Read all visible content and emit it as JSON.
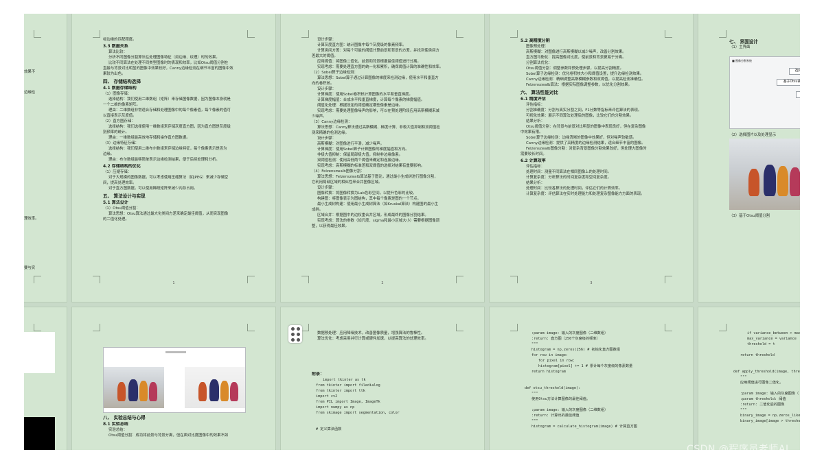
{
  "pages": {
    "p0": [
      "标边缘的匹配程度。"
    ],
    "p1": [
      {
        "c": "",
        "t": "标边缘的匹配程度。"
      },
      {
        "c": "h2",
        "t": "3.3 数据关系"
      },
      {
        "c": "sub",
        "t": "算法比较："
      },
      {
        "c": "sub",
        "t": "分析不同图像分割算法在处理图像特征（如边缘、纹理）时的效果。"
      },
      {
        "c": "sub",
        "t": "比较不同算法在处理不同类型图像时的表现和效率，比如Otsu阈值分割在"
      },
      {
        "c": "",
        "t": "直接与背景对比明显的图像中效果较好，Canny边缘检测在细节丰富的图像中效"
      },
      {
        "c": "",
        "t": "果较为出色。"
      },
      {
        "c": "h1",
        "t": "四、 存储结构选择"
      },
      {
        "c": "h2",
        "t": "4.1 数据存储结构"
      },
      {
        "c": "",
        "t": "（1）图像存储："
      },
      {
        "c": "sub",
        "t": "选择结构：我们使用二维数组（矩阵）来存储图像数据，因为图像本身就是"
      },
      {
        "c": "",
        "t": "一个二维的像素矩阵。"
      },
      {
        "c": "sub",
        "t": "理由：二维数组非常适合存储和处理图像中的每个像素值，每个像素的值可"
      },
      {
        "c": "",
        "t": "以直接表示灰度值。"
      },
      {
        "c": "",
        "t": "（2）直方图存储："
      },
      {
        "c": "sub",
        "t": "选择结构：我们选择使用一维数组来存储灰度直方图，因为直方图是灰度级"
      },
      {
        "c": "",
        "t": "别频率的统计。"
      },
      {
        "c": "sub",
        "t": "理由：一维数组能高效地存储和操作直方图数据。"
      },
      {
        "c": "",
        "t": "（3）边缘特征存储："
      },
      {
        "c": "sub",
        "t": "选择结构：我们使用二维布尔数组来存储边缘特征，每个像素表示是否为"
      },
      {
        "c": "",
        "t": "边缘。"
      },
      {
        "c": "sub",
        "t": "理由：布尔数组能够简单表示边缘检测结果，便于后续处理和分析。"
      },
      {
        "c": "h2",
        "t": "4.2 存储结构的优化"
      },
      {
        "c": "",
        "t": "（1）压缩存储："
      },
      {
        "c": "sub",
        "t": "对于大规模的图像数据，可以考虑使用压缩算法（如JPEG）来减少存储空"
      },
      {
        "c": "",
        "t": "间，提高处理效率。"
      },
      {
        "c": "sub",
        "t": "对于直方图数据，可以使用稀疏矩阵来减少内存占用。"
      },
      {
        "c": "h1",
        "t": "五、 算法设计与实现"
      },
      {
        "c": "h2",
        "t": "5.1 算法设计"
      },
      {
        "c": "",
        "t": "（1）Otsu阈值分割："
      },
      {
        "c": "sub",
        "t": "算法思想：Otsu算法通过最大化类间方差来确定最佳阈值，从而实现图像"
      },
      {
        "c": "",
        "t": "的二值化处理。"
      }
    ],
    "p2": [
      {
        "c": "sub",
        "t": "设计步骤："
      },
      {
        "c": "sub",
        "t": "计算灰度直方图：统计图像中每个灰度级的像素频率。"
      },
      {
        "c": "sub",
        "t": "计算类间方差：对每个可能的阈值计算前景和背景的方差，并找到使类间方"
      },
      {
        "c": "",
        "t": "差最大的阈值。"
      },
      {
        "c": "sub",
        "t": "应用阈值：将图像二值化，前景和背景根据最佳阈值进行分离。"
      },
      {
        "c": "sub",
        "t": "实现考虑：需要处理直方图的统一化和累积，确保阈值计算的准确性和效率。"
      },
      {
        "c": "",
        "t": "（2）Sobel算子边缘检测："
      },
      {
        "c": "sub",
        "t": "算法思想：Sobel算子通过计算图像的梯度来检测边缘，使用水平和垂直方"
      },
      {
        "c": "",
        "t": "向的卷积核。"
      },
      {
        "c": "sub",
        "t": "设计步骤："
      },
      {
        "c": "sub",
        "t": "计算梯度：使用Sobel卷积核计算图像的水平和垂直梯度。"
      },
      {
        "c": "sub",
        "t": "计算梯度幅值：合成水平和垂直梯度，计算每个像素的梯度幅值。"
      },
      {
        "c": "sub",
        "t": "阈值化处理：根据设定的阈值确定哪些像素是边缘。"
      },
      {
        "c": "sub",
        "t": "实现考虑：需要处理图像噪声的影响，可以在预处理阶段应用高斯模糊来减"
      },
      {
        "c": "",
        "t": "少噪声。"
      },
      {
        "c": "",
        "t": "（3）Canny边缘检测："
      },
      {
        "c": "sub",
        "t": "算法思想：Canny算法通过高斯模糊、梯度计算、非极大值抑制和双阈值检"
      },
      {
        "c": "",
        "t": "测来精确的检测边缘。"
      },
      {
        "c": "sub",
        "t": "设计步骤："
      },
      {
        "c": "sub",
        "t": "高斯模糊：对图像进行平滑，减少噪声。"
      },
      {
        "c": "sub",
        "t": "计算梯度：使用Sobel算子计算图像的梯度幅值和方向。"
      },
      {
        "c": "sub",
        "t": "非极大值抑制：保留局部极大值，抑制非边缘像素。"
      },
      {
        "c": "sub",
        "t": "双阈值检测：使用高低两个阈值来确定和连接边缘。"
      },
      {
        "c": "sub",
        "t": "实现考虑：高斯模糊的标准差和双阈值的选择对结果有重要影响。"
      },
      {
        "c": "",
        "t": "（4）Felzenszwalb图像分割："
      },
      {
        "c": "sub",
        "t": "算法思想：Felzenszwalb算法基于图论，通过最小生成树进行图像分割，"
      },
      {
        "c": "",
        "t": "它利用局部区域的相似性来合并图像区域。"
      },
      {
        "c": "sub",
        "t": "设计步骤："
      },
      {
        "c": "sub",
        "t": "图像转换：将图像转换为Lab色彩空间，以提升色彩的比较。"
      },
      {
        "c": "sub",
        "t": "构建图：将图像表示为图结构，其中每个像素是图的一个节点。"
      },
      {
        "c": "sub",
        "t": "最小生成树构建：使用最小生成树算法（如Kruskal算法）构建图的最小生"
      },
      {
        "c": "",
        "t": "成树。"
      },
      {
        "c": "sub",
        "t": "区域合并：根据图中的边权重合并区域，形成最终的图像分割结果。"
      },
      {
        "c": "sub",
        "t": "实现考虑：算法的参数（如尺度、sigma和最小区域大小）需要根据图像调"
      },
      {
        "c": "",
        "t": "整，以获得最佳效果。"
      }
    ],
    "p3": [
      {
        "c": "h2",
        "t": "5.2 高精度分割"
      },
      {
        "c": "sub",
        "t": "图像预处理："
      },
      {
        "c": "sub",
        "t": "高斯模糊：对图像进行高斯模糊以减少噪声，改善分割效果。"
      },
      {
        "c": "sub",
        "t": "直方图均衡化：提高图像对比度，使前景和背景更易于分离。"
      },
      {
        "c": "sub",
        "t": "分割算法优化："
      },
      {
        "c": "sub",
        "t": "Otsu阈值分割：调整参数和预处理步骤，以提高分割精度。"
      },
      {
        "c": "sub",
        "t": "Sobel算子边缘检测：优化卷积核大小和阈值设置，提升边缘检测效果。"
      },
      {
        "c": "sub",
        "t": "Canny边缘检测：精细调整高斯模糊参数和双阈值，以提高检测准确性。"
      },
      {
        "c": "sub",
        "t": "Felzenszwalb算法：根据实际图像调整参数，以优化分割效果。"
      },
      {
        "c": "h1",
        "t": "六、 算法性能对比"
      },
      {
        "c": "h2",
        "t": "6.1 精度评估"
      },
      {
        "c": "sub",
        "t": "评估指标："
      },
      {
        "c": "sub",
        "t": "分割准确度：分割与真实分割之间，F1分数等指标来评估算法的表现。"
      },
      {
        "c": "sub",
        "t": "可视化效果：展示不同算法处理后的图像，比较它们的分割效果。"
      },
      {
        "c": "sub",
        "t": "结果分析："
      },
      {
        "c": "sub",
        "t": "Otsu阈值分割：在背景与前景对比明显的图像中表现良好，但在复杂图像"
      },
      {
        "c": "",
        "t": "中效果有限。"
      },
      {
        "c": "sub",
        "t": "Sobel算子边缘检测：边缘清晰的图像中效果好，但对噪声较敏感。"
      },
      {
        "c": "sub",
        "t": "Canny边缘检测：提供了高精度的边缘检测结果，适合细节丰富的图像。"
      },
      {
        "c": "sub",
        "t": "Felzenszwalb图像分割：对复杂背景图像分割效果较好，但处理大图像时"
      },
      {
        "c": "",
        "t": "需要较长时间。"
      },
      {
        "c": "h2",
        "t": "6.2 计算效率"
      },
      {
        "c": "sub",
        "t": "评估指标："
      },
      {
        "c": "sub",
        "t": "处理时间：测量不同算法在相同图像上的处理时间。"
      },
      {
        "c": "sub",
        "t": "计算复杂度：分析算法的时间复杂度和空间复杂度。"
      },
      {
        "c": "sub",
        "t": "结果分析："
      },
      {
        "c": "sub",
        "t": "处理时间：比较各算法的处理时间，评估它们的计算效率。"
      },
      {
        "c": "sub",
        "t": "计算复杂度：评估算法在实时处理能力和处理复杂图像能力方面的表现。"
      }
    ],
    "p4": [
      {
        "c": "h1",
        "t": "七、 界面设计"
      },
      {
        "c": "",
        "t": "（1）主界面"
      }
    ],
    "p4_caption2": "（2）选择图片以及处理显示",
    "p4_caption3": "（3）基于Otsu阈值分割",
    "p4_app": {
      "btn1": "选择图",
      "btn2": "基于Otsu阈值",
      "btn3": "边"
    },
    "p7": [
      {
        "c": "h1",
        "t": "八、 实验总结与心得"
      },
      {
        "c": "h2",
        "t": "8.1 实验总结"
      },
      {
        "c": "sub",
        "t": "实验总结："
      },
      {
        "c": "sub",
        "t": "Otsu阈值分割：成功将前景与背景分离，但在面对比度图像中的效果不如"
      }
    ],
    "p8_top": [
      {
        "c": "sub",
        "t": "数据预处理：应用降噪技术，改善图像质量，增强算法的鲁棒性。"
      },
      {
        "c": "sub",
        "t": "算法优化：考虑采用并行计算或硬件加速，以提高算法的处理效率。"
      }
    ],
    "p8_code": [
      {
        "c": "h2",
        "t": "附录："
      },
      {
        "c": "code i2",
        "t": "import tkinter as tk"
      },
      {
        "c": "code",
        "t": "from tkinter import filedialog"
      },
      {
        "c": "code",
        "t": "from tkinter import ttk"
      },
      {
        "c": "code",
        "t": "import cv2"
      },
      {
        "c": "code",
        "t": "from PIL import Image, ImageTk"
      },
      {
        "c": "code",
        "t": "import numpy as np"
      },
      {
        "c": "code",
        "t": "from skimage import segmentation, color"
      },
      {
        "c": "code",
        "t": ""
      },
      {
        "c": "code",
        "t": ""
      },
      {
        "c": "code",
        "t": "# 定义算法函数"
      }
    ],
    "p9": [
      {
        "c": "code i2",
        "t": ":param image: 输入的灰度图像（二维数组）"
      },
      {
        "c": "code i2",
        "t": ":return: 直方图（256个灰度级的频率）"
      },
      {
        "c": "code i2",
        "t": "\"\"\""
      },
      {
        "c": "code i2",
        "t": "histogram = np.zeros(256)  # 初始化直方图数组"
      },
      {
        "c": "code i2",
        "t": "for row in image:"
      },
      {
        "c": "code i3",
        "t": "for pixel in row:"
      },
      {
        "c": "code i3",
        "t": "    histogram[pixel] += 1  # 累计每个灰度级的像素数量"
      },
      {
        "c": "code i2",
        "t": "return histogram"
      },
      {
        "c": "code",
        "t": ""
      },
      {
        "c": "code",
        "t": ""
      },
      {
        "c": "code",
        "t": "def otsu_threshold(image):"
      },
      {
        "c": "code i2",
        "t": "\"\"\""
      },
      {
        "c": "code i2",
        "t": "使用Otsu方法计算图像的最佳阈值。"
      },
      {
        "c": "code",
        "t": ""
      },
      {
        "c": "code i2",
        "t": ":param image: 输入的灰度图像（二维数组）"
      },
      {
        "c": "code i2",
        "t": ":return: 计算出的最佳阈值"
      },
      {
        "c": "code i2",
        "t": "\"\"\""
      },
      {
        "c": "code i2",
        "t": "histogram = calculate_histogram(image)  # 计算直方图"
      }
    ],
    "p10": [
      {
        "c": "code i3",
        "t": "if variance_between > max_"
      },
      {
        "c": "code i3",
        "t": "    max_variance = variance"
      },
      {
        "c": "code i3",
        "t": "    threshold = t"
      },
      {
        "c": "code",
        "t": ""
      },
      {
        "c": "code i2",
        "t": "return threshold"
      },
      {
        "c": "code",
        "t": ""
      },
      {
        "c": "code",
        "t": ""
      },
      {
        "c": "code",
        "t": "def apply_threshold(image, thresho"
      },
      {
        "c": "code i2",
        "t": "\"\"\""
      },
      {
        "c": "code i2",
        "t": "应用阈值进行图像二值化。"
      },
      {
        "c": "code",
        "t": ""
      },
      {
        "c": "code i2",
        "t": ":param image: 输入的灰度图像（"
      },
      {
        "c": "code i2",
        "t": ":param threshold: 阈值"
      },
      {
        "c": "code i2",
        "t": ":return: 二值化后的图像"
      },
      {
        "c": "code i2",
        "t": "\"\"\""
      },
      {
        "c": "code i2",
        "t": "binary_image = np.zeros_like(i"
      },
      {
        "c": "code i2",
        "t": "binary_image[image > threshold"
      }
    ],
    "left_cut_top": [
      "效果不",
      "",
      "",
      "",
      "",
      "",
      "",
      "",
      "",
      "",
      "",
      "",
      "",
      "",
      "",
      "",
      "",
      "",
      "",
      "",
      "",
      "",
      "",
      "",
      "",
      "",
      "",
      "",
      "",
      "",
      "",
      "",
      "",
      "",
      "",
      "",
      "",
      "",
      "",
      ""
    ],
    "page_numbers": {
      "p1": "1",
      "p2": "2",
      "p3": "3"
    }
  },
  "watermark": "CSDN @程序员老师AI",
  "left_cut": {
    "l1": "效果不",
    "l2": "边缘检",
    "l3": "理效率。",
    "l4": "要与实"
  }
}
